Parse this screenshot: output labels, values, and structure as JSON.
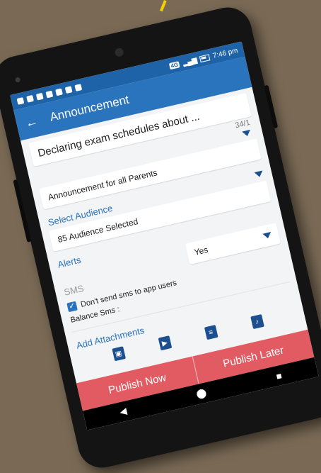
{
  "status_bar": {
    "network": "4G",
    "time": "7:46 pm"
  },
  "app_bar": {
    "title": "Announcement",
    "back_icon": "arrow-left-icon"
  },
  "form": {
    "subject_value": "Declaring exam schedules about ...",
    "char_counter": "34/1",
    "announcement_type": "Announcement for all Parents",
    "select_audience_label": "Select Audience",
    "audience_value": "85 Audience Selected",
    "alerts_label": "Alerts",
    "sms_label": "SMS",
    "sms_value": "Yes",
    "dont_send_label": "Don't send sms to app users",
    "dont_send_checked": true,
    "balance_label": "Balance Sms :",
    "add_attachments_label": "Add Attachments"
  },
  "attachments": {
    "icons": [
      "image-icon",
      "video-icon",
      "document-icon",
      "audio-icon"
    ]
  },
  "actions": {
    "publish_now": "Publish Now",
    "publish_later": "Publish Later"
  },
  "colors": {
    "primary": "#2a73bd",
    "publish": "#e25b62"
  }
}
